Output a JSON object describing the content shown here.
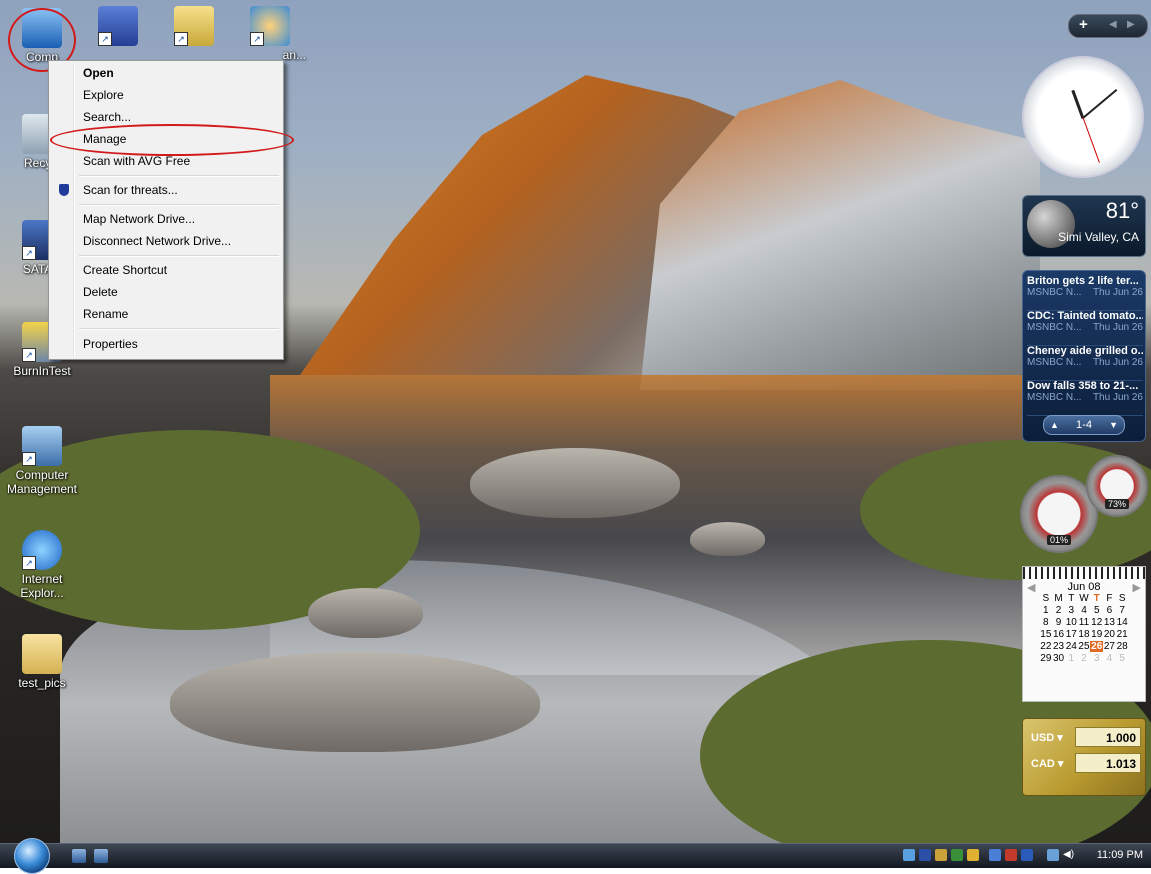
{
  "desktop": {
    "icons": [
      {
        "label": "Comp",
        "icon": "computer-icon"
      },
      {
        "label": "",
        "icon": "word-wizard-icon"
      },
      {
        "label": "",
        "icon": "folder-app-icon"
      },
      {
        "label": "an...",
        "icon": "satellite-icon"
      },
      {
        "label": "Recycl",
        "icon": "recycle-bin-icon"
      },
      {
        "label": "SATAR",
        "icon": "sata-icon"
      },
      {
        "label": "BurnInTest",
        "icon": "burnintest-icon"
      },
      {
        "label": "Computer Management",
        "icon": "computer-management-icon"
      },
      {
        "label": "Internet Explor...",
        "icon": "internet-explorer-icon"
      },
      {
        "label": "test_pics",
        "icon": "folder-icon"
      }
    ]
  },
  "context_menu": {
    "items": [
      {
        "label": "Open",
        "bold": true
      },
      {
        "label": "Explore"
      },
      {
        "label": "Search..."
      },
      {
        "label": "Manage",
        "highlighted_by_annotation": true
      },
      {
        "label": "Scan with AVG Free"
      },
      {
        "label": "Scan for threats...",
        "icon": "shield-icon"
      },
      {
        "label": "Map Network Drive..."
      },
      {
        "label": "Disconnect Network Drive..."
      },
      {
        "label": "Create Shortcut"
      },
      {
        "label": "Delete"
      },
      {
        "label": "Rename"
      },
      {
        "label": "Properties"
      }
    ]
  },
  "sidebar": {
    "weather": {
      "temp": "81°",
      "city": "Simi Valley, CA"
    },
    "news": {
      "items": [
        {
          "title": "Briton gets 2 life ter...",
          "source": "MSNBC N...",
          "date": "Thu Jun 26"
        },
        {
          "title": "CDC: Tainted tomato...",
          "source": "MSNBC N...",
          "date": "Thu Jun 26"
        },
        {
          "title": "Cheney aide grilled o...",
          "source": "MSNBC N...",
          "date": "Thu Jun 26"
        },
        {
          "title": "Dow falls 358 to 21-...",
          "source": "MSNBC N...",
          "date": "Thu Jun 26"
        }
      ],
      "page": "1-4"
    },
    "meters": {
      "cpu": "01%",
      "memory": "73%"
    },
    "calendar": {
      "month": "Jun 08",
      "headers": [
        "S",
        "M",
        "T",
        "W",
        "T",
        "F",
        "S"
      ],
      "days": [
        "1",
        "2",
        "3",
        "4",
        "5",
        "6",
        "7",
        "8",
        "9",
        "10",
        "11",
        "12",
        "13",
        "14",
        "15",
        "16",
        "17",
        "18",
        "19",
        "20",
        "21",
        "22",
        "23",
        "24",
        "25",
        "26",
        "27",
        "28",
        "29",
        "30",
        "1",
        "2",
        "3",
        "4",
        "5"
      ],
      "today": "26"
    },
    "currency": [
      {
        "code": "USD",
        "value": "1.000"
      },
      {
        "code": "CAD",
        "value": "1.013"
      }
    ]
  },
  "taskbar": {
    "clock": "11:09 PM"
  }
}
